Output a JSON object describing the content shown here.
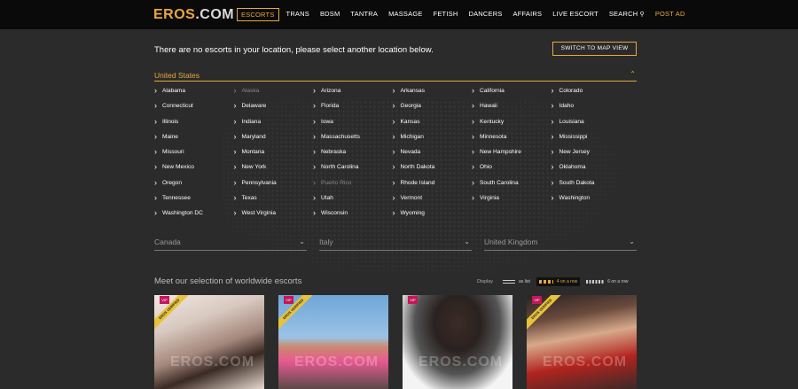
{
  "header": {
    "logo_main": "EROS",
    "logo_suffix": ".COM",
    "nav": [
      {
        "label": "ESCORTS",
        "active": true
      },
      {
        "label": "TRANS"
      },
      {
        "label": "BDSM"
      },
      {
        "label": "TANTRA"
      },
      {
        "label": "MASSAGE"
      },
      {
        "label": "FETISH"
      },
      {
        "label": "DANCERS"
      },
      {
        "label": "AFFAIRS"
      },
      {
        "label": "LIVE ESCORT"
      },
      {
        "label": "SEARCH"
      },
      {
        "label": "POST AD"
      }
    ]
  },
  "location": {
    "message": "There are no escorts in your location, please select another location below.",
    "map_button": "SWITCH TO MAP VIEW",
    "country": "United States",
    "states": [
      {
        "name": "Alabama"
      },
      {
        "name": "Alaska",
        "dim": true
      },
      {
        "name": "Arizona"
      },
      {
        "name": "Arkansas"
      },
      {
        "name": "California"
      },
      {
        "name": "Colorado"
      },
      {
        "name": "Connecticut"
      },
      {
        "name": "Delaware"
      },
      {
        "name": "Florida"
      },
      {
        "name": "Georgia"
      },
      {
        "name": "Hawaii"
      },
      {
        "name": "Idaho"
      },
      {
        "name": "Illinois"
      },
      {
        "name": "Indiana"
      },
      {
        "name": "Iowa"
      },
      {
        "name": "Kansas"
      },
      {
        "name": "Kentucky"
      },
      {
        "name": "Louisiana"
      },
      {
        "name": "Maine"
      },
      {
        "name": "Maryland"
      },
      {
        "name": "Massachusetts"
      },
      {
        "name": "Michigan"
      },
      {
        "name": "Minnesota"
      },
      {
        "name": "Mississippi"
      },
      {
        "name": "Missouri"
      },
      {
        "name": "Montana"
      },
      {
        "name": "Nebraska"
      },
      {
        "name": "Nevada"
      },
      {
        "name": "New Hampshire"
      },
      {
        "name": "New Jersey"
      },
      {
        "name": "New Mexico"
      },
      {
        "name": "New York"
      },
      {
        "name": "North Carolina"
      },
      {
        "name": "North Dakota"
      },
      {
        "name": "Ohio"
      },
      {
        "name": "Oklahoma"
      },
      {
        "name": "Oregon"
      },
      {
        "name": "Pennsylvania"
      },
      {
        "name": "Puerto Rico",
        "dim": true
      },
      {
        "name": "Rhode Island"
      },
      {
        "name": "South Carolina"
      },
      {
        "name": "South Dakota"
      },
      {
        "name": "Tennessee"
      },
      {
        "name": "Texas"
      },
      {
        "name": "Utah"
      },
      {
        "name": "Vermont"
      },
      {
        "name": "Virginia"
      },
      {
        "name": "Washington"
      },
      {
        "name": "Washington DC"
      },
      {
        "name": "West Virginia"
      },
      {
        "name": "Wisconsin"
      },
      {
        "name": "Wyoming"
      }
    ],
    "dropdowns": [
      "Canada",
      "Italy",
      "United Kingdom"
    ]
  },
  "selection": {
    "title": "Meet our selection of worldwide escorts",
    "display_label": "Display",
    "display_options": [
      {
        "label": "as list"
      },
      {
        "label": "4 on a row",
        "active": true
      },
      {
        "label": "6 on a row"
      }
    ],
    "badge_vip": "VIP",
    "badge_verified": "EROS VERIFIED",
    "watermark": "EROS.COM"
  },
  "colors": {
    "accent": "#e8a93b",
    "vip": "#c2185b"
  }
}
